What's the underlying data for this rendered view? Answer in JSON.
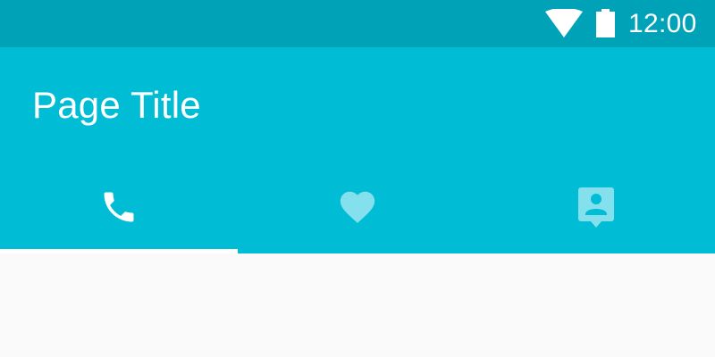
{
  "status_bar": {
    "time": "12:00",
    "icons": [
      "wifi-icon",
      "battery-icon"
    ]
  },
  "app_bar": {
    "title": "Page Title"
  },
  "tabs": {
    "items": [
      {
        "icon": "phone-icon",
        "selected": true
      },
      {
        "icon": "heart-icon",
        "selected": false
      },
      {
        "icon": "contact-icon",
        "selected": false
      }
    ]
  },
  "colors": {
    "status_bar": "#00a2b8",
    "app_bar": "#00bcd4",
    "indicator": "#ffffff",
    "background": "#fafafa",
    "inactive_icon": "#84e0ec"
  }
}
